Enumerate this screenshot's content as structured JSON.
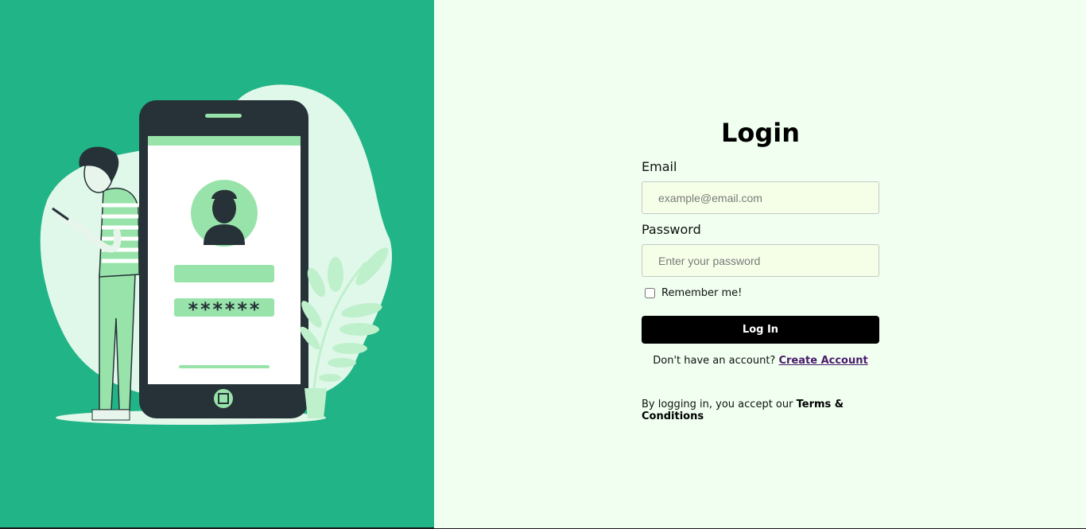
{
  "login_form": {
    "title": "Login",
    "email_label": "Email",
    "email_placeholder": "example@email.com",
    "email_value": "",
    "password_label": "Password",
    "password_placeholder": "Enter your password",
    "password_value": "",
    "remember_label": "Remember me!",
    "remember_checked": false,
    "login_button_label": "Log In",
    "signup_prompt": "Don't have an account?",
    "signup_link_label": "Create Account",
    "terms_prefix": "By logging in, you accept our",
    "terms_link_label": "Terms & Conditions"
  },
  "illustration": {
    "icon": "phone-login-illustration",
    "masked_password_text": "******"
  },
  "colors": {
    "left_panel_bg": "#21b486",
    "right_panel_bg": "#f0fff0",
    "button_bg": "#000000",
    "link_color": "#4a1a6b",
    "input_bg": "#f5ffe8"
  }
}
